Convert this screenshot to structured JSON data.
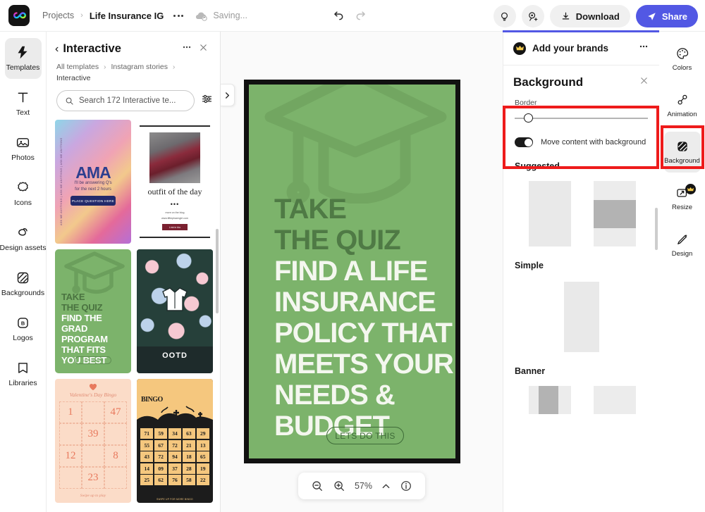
{
  "app": {
    "logo_icon": "adobe-express-logo",
    "breadcrumb_projects": "Projects",
    "breadcrumb_sep": "›",
    "doc_title": "Life Insurance IG",
    "saving_status": "Saving...",
    "cloud_icon": "cloud-sync-icon",
    "more_icon": "more-options-icon"
  },
  "topbar": {
    "undo_icon": "undo-icon",
    "redo_icon": "redo-icon",
    "lightbulb_icon": "ideas-icon",
    "invite_icon": "invite-collaborator-icon",
    "download_label": "Download",
    "download_icon": "download-icon",
    "share_label": "Share",
    "share_icon": "send-icon",
    "share_color": "#5258e4"
  },
  "left_rail": {
    "items": [
      {
        "label": "Templates",
        "icon": "templates-icon",
        "selected": true
      },
      {
        "label": "Text",
        "icon": "text-icon",
        "selected": false
      },
      {
        "label": "Photos",
        "icon": "photos-icon",
        "selected": false
      },
      {
        "label": "Icons",
        "icon": "icons-icon",
        "selected": false
      },
      {
        "label": "Design assets",
        "icon": "design-assets-icon",
        "selected": false
      },
      {
        "label": "Backgrounds",
        "icon": "backgrounds-icon",
        "selected": false
      },
      {
        "label": "Logos",
        "icon": "logos-icon",
        "selected": false
      },
      {
        "label": "Libraries",
        "icon": "libraries-icon",
        "selected": false
      }
    ]
  },
  "template_panel": {
    "back_icon": "chevron-left-icon",
    "title": "Interactive",
    "more_icon": "more-options-icon",
    "close_icon": "close-icon",
    "breadcrumb": {
      "root": "All templates",
      "category": "Instagram stories",
      "current": "Interactive",
      "sep": "›"
    },
    "search": {
      "icon": "search-icon",
      "placeholder": "Search 172 Interactive te...",
      "filter_icon": "filter-icon"
    },
    "collapse_icon": "chevron-right-icon",
    "templates": [
      {
        "name": "ama-template",
        "side_text": "ASK ME ANYTHING | ASK ME ANYTHING | ASK ME ANYTHING",
        "title": "AMA",
        "sub_1": "I'll be answering Q's",
        "sub_2": "for the next 2 hours",
        "button": "PLACE QUESTION HERE"
      },
      {
        "name": "outfit-of-the-day-template",
        "caption": "outfit of the day",
        "dots": "•••",
        "line_1": "more on the blog",
        "line_2": "www.fiftiepharmgirl.com",
        "button": "Link in bio"
      },
      {
        "name": "grad-quiz-template",
        "lines_dark": [
          "TAKE",
          "THE QUIZ"
        ],
        "lines_white": [
          "FIND THE",
          "GRAD",
          "PROGRAM",
          "THAT FITS",
          "YOU BEST"
        ],
        "cta": "LETS DO THIS"
      },
      {
        "name": "ootd-floral-template",
        "label": "OOTD",
        "icon": "shirt-icon"
      },
      {
        "name": "valentines-bingo-template",
        "title": "Valentine's Day Bingo",
        "footer": "Swipe up to play",
        "heart_icon": "heart-icon",
        "numbers": [
          "1",
          "",
          "47",
          "",
          "39",
          "",
          "12",
          "",
          "8",
          "",
          "23",
          ""
        ]
      },
      {
        "name": "halloween-bingo-template",
        "title": "BINGO",
        "footer": "SWIPE UP FOR MORE BINGO",
        "numbers": [
          "71",
          "59",
          "34",
          "63",
          "29",
          "55",
          "67",
          "72",
          "21",
          "13",
          "43",
          "72",
          "94",
          "18",
          "65",
          "14",
          "09",
          "37",
          "28",
          "19",
          "25",
          "62",
          "76",
          "58",
          "22"
        ]
      }
    ]
  },
  "canvas": {
    "artboard": {
      "name": "life-insurance-quiz-story",
      "background_color": "#7cb36b",
      "graduation_cap_icon": "graduation-cap-icon",
      "lines_dark": [
        "TAKE",
        "THE QUIZ"
      ],
      "lines_white": [
        "FIND A LIFE",
        "INSURANCE",
        "POLICY THAT",
        "MEETS YOUR",
        "NEEDS &",
        "BUDGET"
      ],
      "cta": "LETS DO THIS"
    },
    "zoom_bar": {
      "zoom_out_icon": "zoom-out-icon",
      "zoom_in_icon": "zoom-in-icon",
      "zoom_level": "57%",
      "chevron_icon": "chevron-up-icon",
      "info_icon": "info-icon"
    }
  },
  "right_panel": {
    "accent_color": "#5258e4",
    "highlight_color": "#ee1b1b",
    "brand_row": {
      "label": "Add your brands",
      "crown_icon": "crown-icon",
      "more_icon": "more-options-icon"
    },
    "title": "Background",
    "close_icon": "close-icon",
    "border": {
      "label": "Border",
      "value": 5
    },
    "move_content": {
      "label": "Move content with background",
      "enabled": true
    },
    "sections": [
      {
        "label": "Suggested"
      },
      {
        "label": "Simple"
      },
      {
        "label": "Banner"
      }
    ]
  },
  "right_rail": {
    "items": [
      {
        "label": "Colors",
        "icon": "colors-icon",
        "selected": false,
        "premium": false
      },
      {
        "label": "Animation",
        "icon": "animation-icon",
        "selected": false,
        "premium": false
      },
      {
        "label": "Background",
        "icon": "background-icon",
        "selected": true,
        "premium": false
      },
      {
        "label": "Resize",
        "icon": "resize-icon",
        "selected": false,
        "premium": true
      },
      {
        "label": "Design",
        "icon": "design-icon",
        "selected": false,
        "premium": false
      }
    ]
  }
}
